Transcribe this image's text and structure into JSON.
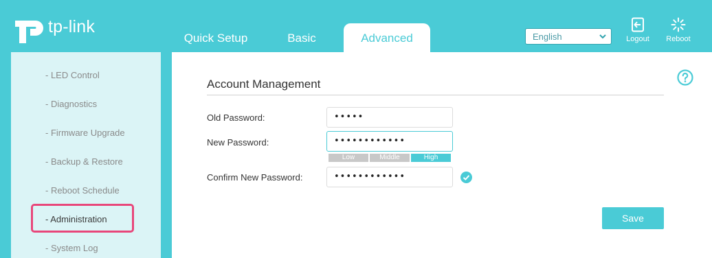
{
  "brand": {
    "name": "tp-link"
  },
  "tabs": [
    {
      "label": "Quick Setup"
    },
    {
      "label": "Basic"
    },
    {
      "label": "Advanced",
      "active": true
    }
  ],
  "header": {
    "language": "English",
    "logout_label": "Logout",
    "reboot_label": "Reboot"
  },
  "sidebar": {
    "items": [
      {
        "label": "- LED Control"
      },
      {
        "label": "- Diagnostics"
      },
      {
        "label": "- Firmware Upgrade"
      },
      {
        "label": "- Backup & Restore"
      },
      {
        "label": "- Reboot Schedule"
      },
      {
        "label": "- Administration",
        "active": true
      },
      {
        "label": "- System Log"
      }
    ]
  },
  "main": {
    "section_title": "Account Management",
    "fields": {
      "old_password": {
        "label": "Old Password:",
        "value": "•••••"
      },
      "new_password": {
        "label": "New Password:",
        "value": "••••••••••••"
      },
      "confirm_password": {
        "label": "Confirm New Password:",
        "value": "••••••••••••"
      }
    },
    "strength": {
      "levels": [
        "Low",
        "Middle",
        "High"
      ],
      "current": "High"
    },
    "save_label": "Save"
  },
  "colors": {
    "accent": "#4acbd6",
    "sidebar_bg": "#dbf4f6",
    "highlight": "#e8467a"
  },
  "icons": [
    "tp-link-logo-icon",
    "chevron-down-icon",
    "logout-icon",
    "reboot-icon",
    "help-icon",
    "check-icon"
  ]
}
